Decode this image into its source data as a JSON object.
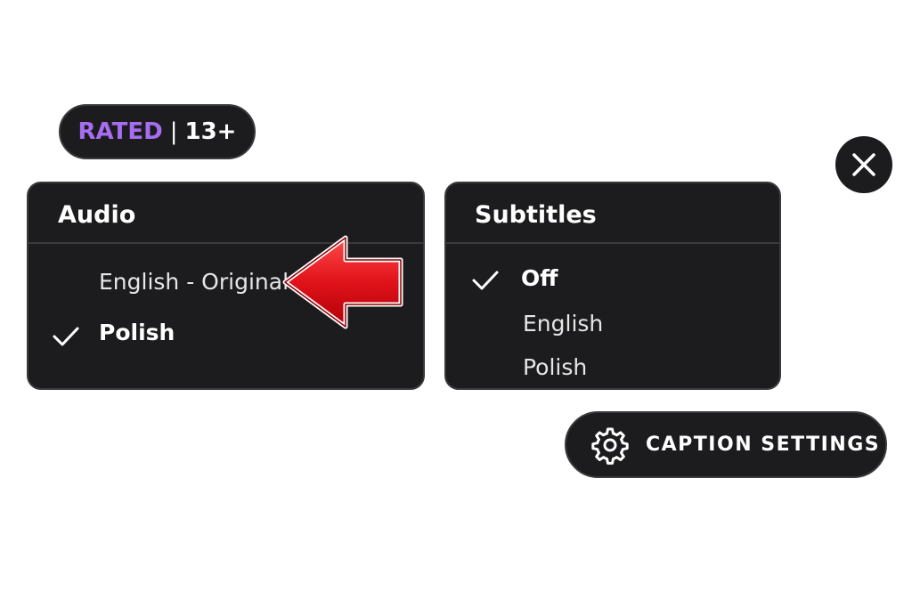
{
  "rating": {
    "rated": "RATED",
    "separator": "|",
    "age": "13+"
  },
  "close": {
    "icon": "close-icon"
  },
  "audio": {
    "title": "Audio",
    "options": [
      {
        "label": "English - Original",
        "selected": false
      },
      {
        "label": "Polish",
        "selected": true
      }
    ]
  },
  "subtitles": {
    "title": "Subtitles",
    "options": [
      {
        "label": "Off",
        "selected": true
      },
      {
        "label": "English",
        "selected": false
      },
      {
        "label": "Polish",
        "selected": false
      }
    ]
  },
  "caption_settings": {
    "label": "CAPTION SETTINGS",
    "icon": "gear-icon"
  },
  "colors": {
    "panel_bg": "#1c1c1e",
    "border": "#3a3a3c",
    "rated_accent": "#a66df0",
    "arrow_red": "#e0121a"
  }
}
